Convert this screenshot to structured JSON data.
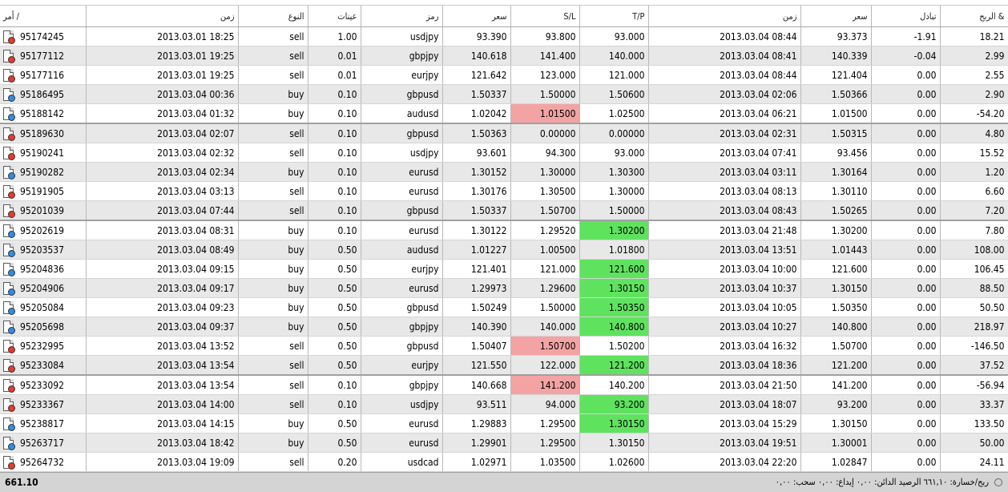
{
  "headers": {
    "ticket": "أمر  /",
    "open_time": "زمن",
    "type": "النوع",
    "size": "عينات",
    "symbol": "رمز",
    "open_price": "سعر",
    "sl": "S/L",
    "tp": "T/P",
    "close_time": "زمن",
    "close_price": "سعر",
    "swap": "تبادل",
    "profit": "الربح &"
  },
  "rows": [
    {
      "ticket": "95174245",
      "open_time": "2013.03.01 18:25",
      "type": "sell",
      "size": "1.00",
      "symbol": "usdjpy",
      "open_price": "93.390",
      "sl": "93.800",
      "tp": "93.000",
      "close_time": "2013.03.04 08:44",
      "close_price": "93.373",
      "swap": "-1.91",
      "profit": "18.21"
    },
    {
      "ticket": "95177112",
      "open_time": "2013.03.01 19:25",
      "type": "sell",
      "size": "0.01",
      "symbol": "gbpjpy",
      "open_price": "140.618",
      "sl": "141.400",
      "tp": "140.000",
      "close_time": "2013.03.04 08:41",
      "close_price": "140.339",
      "swap": "-0.04",
      "profit": "2.99"
    },
    {
      "ticket": "95177116",
      "open_time": "2013.03.01 19:25",
      "type": "sell",
      "size": "0.01",
      "symbol": "eurjpy",
      "open_price": "121.642",
      "sl": "123.000",
      "tp": "121.000",
      "close_time": "2013.03.04 08:44",
      "close_price": "121.404",
      "swap": "0.00",
      "profit": "2.55"
    },
    {
      "ticket": "95186495",
      "open_time": "2013.03.04 00:36",
      "type": "buy",
      "size": "0.10",
      "symbol": "gbpusd",
      "open_price": "1.50337",
      "sl": "1.50000",
      "tp": "1.50600",
      "close_time": "2013.03.04 02:06",
      "close_price": "1.50366",
      "swap": "0.00",
      "profit": "2.90"
    },
    {
      "ticket": "95188142",
      "open_time": "2013.03.04 01:32",
      "type": "buy",
      "size": "0.10",
      "symbol": "audusd",
      "open_price": "1.02042",
      "sl": "1.01500",
      "tp": "1.02500",
      "close_time": "2013.03.04 06:21",
      "close_price": "1.01500",
      "swap": "0.00",
      "profit": "-54.20",
      "sl_hit": true
    },
    {
      "ticket": "95189630",
      "open_time": "2013.03.04 02:07",
      "type": "sell",
      "size": "0.10",
      "symbol": "gbpusd",
      "open_price": "1.50363",
      "sl": "0.00000",
      "tp": "0.00000",
      "close_time": "2013.03.04 02:31",
      "close_price": "1.50315",
      "swap": "0.00",
      "profit": "4.80",
      "sep": true
    },
    {
      "ticket": "95190241",
      "open_time": "2013.03.04 02:32",
      "type": "sell",
      "size": "0.10",
      "symbol": "usdjpy",
      "open_price": "93.601",
      "sl": "94.300",
      "tp": "93.000",
      "close_time": "2013.03.04 07:41",
      "close_price": "93.456",
      "swap": "0.00",
      "profit": "15.52"
    },
    {
      "ticket": "95190282",
      "open_time": "2013.03.04 02:34",
      "type": "buy",
      "size": "0.10",
      "symbol": "eurusd",
      "open_price": "1.30152",
      "sl": "1.30000",
      "tp": "1.30300",
      "close_time": "2013.03.04 03:11",
      "close_price": "1.30164",
      "swap": "0.00",
      "profit": "1.20"
    },
    {
      "ticket": "95191905",
      "open_time": "2013.03.04 03:13",
      "type": "sell",
      "size": "0.10",
      "symbol": "eurusd",
      "open_price": "1.30176",
      "sl": "1.30500",
      "tp": "1.30000",
      "close_time": "2013.03.04 08:13",
      "close_price": "1.30110",
      "swap": "0.00",
      "profit": "6.60"
    },
    {
      "ticket": "95201039",
      "open_time": "2013.03.04 07:44",
      "type": "sell",
      "size": "0.10",
      "symbol": "gbpusd",
      "open_price": "1.50337",
      "sl": "1.50700",
      "tp": "1.50000",
      "close_time": "2013.03.04 08:43",
      "close_price": "1.50265",
      "swap": "0.00",
      "profit": "7.20"
    },
    {
      "ticket": "95202619",
      "open_time": "2013.03.04 08:31",
      "type": "buy",
      "size": "0.10",
      "symbol": "eurusd",
      "open_price": "1.30122",
      "sl": "1.29520",
      "tp": "1.30200",
      "close_time": "2013.03.04 21:48",
      "close_price": "1.30200",
      "swap": "0.00",
      "profit": "7.80",
      "tp_hit": true,
      "sep": true
    },
    {
      "ticket": "95203537",
      "open_time": "2013.03.04 08:49",
      "type": "buy",
      "size": "0.50",
      "symbol": "audusd",
      "open_price": "1.01227",
      "sl": "1.00500",
      "tp": "1.01800",
      "close_time": "2013.03.04 13:51",
      "close_price": "1.01443",
      "swap": "0.00",
      "profit": "108.00"
    },
    {
      "ticket": "95204836",
      "open_time": "2013.03.04 09:15",
      "type": "buy",
      "size": "0.50",
      "symbol": "eurjpy",
      "open_price": "121.401",
      "sl": "121.000",
      "tp": "121.600",
      "close_time": "2013.03.04 10:00",
      "close_price": "121.600",
      "swap": "0.00",
      "profit": "106.45",
      "tp_hit": true
    },
    {
      "ticket": "95204906",
      "open_time": "2013.03.04 09:17",
      "type": "buy",
      "size": "0.50",
      "symbol": "eurusd",
      "open_price": "1.29973",
      "sl": "1.29600",
      "tp": "1.30150",
      "close_time": "2013.03.04 10:37",
      "close_price": "1.30150",
      "swap": "0.00",
      "profit": "88.50",
      "tp_hit": true
    },
    {
      "ticket": "95205084",
      "open_time": "2013.03.04 09:23",
      "type": "buy",
      "size": "0.50",
      "symbol": "gbpusd",
      "open_price": "1.50249",
      "sl": "1.50000",
      "tp": "1.50350",
      "close_time": "2013.03.04 10:05",
      "close_price": "1.50350",
      "swap": "0.00",
      "profit": "50.50",
      "tp_hit": true
    },
    {
      "ticket": "95205698",
      "open_time": "2013.03.04 09:37",
      "type": "buy",
      "size": "0.50",
      "symbol": "gbpjpy",
      "open_price": "140.390",
      "sl": "140.000",
      "tp": "140.800",
      "close_time": "2013.03.04 10:27",
      "close_price": "140.800",
      "swap": "0.00",
      "profit": "218.97",
      "tp_hit": true
    },
    {
      "ticket": "95232995",
      "open_time": "2013.03.04 13:52",
      "type": "sell",
      "size": "0.50",
      "symbol": "gbpusd",
      "open_price": "1.50407",
      "sl": "1.50700",
      "tp": "1.50200",
      "close_time": "2013.03.04 16:32",
      "close_price": "1.50700",
      "swap": "0.00",
      "profit": "-146.50",
      "sl_hit": true
    },
    {
      "ticket": "95233084",
      "open_time": "2013.03.04 13:54",
      "type": "sell",
      "size": "0.50",
      "symbol": "eurjpy",
      "open_price": "121.550",
      "sl": "122.000",
      "tp": "121.200",
      "close_time": "2013.03.04 18:36",
      "close_price": "121.200",
      "swap": "0.00",
      "profit": "37.52",
      "tp_hit": true
    },
    {
      "ticket": "95233092",
      "open_time": "2013.03.04 13:54",
      "type": "sell",
      "size": "0.10",
      "symbol": "gbpjpy",
      "open_price": "140.668",
      "sl": "141.200",
      "tp": "140.200",
      "close_time": "2013.03.04 21:50",
      "close_price": "141.200",
      "swap": "0.00",
      "profit": "-56.94",
      "sl_hit": true,
      "sep": true
    },
    {
      "ticket": "95233367",
      "open_time": "2013.03.04 14:00",
      "type": "sell",
      "size": "0.10",
      "symbol": "usdjpy",
      "open_price": "93.511",
      "sl": "94.000",
      "tp": "93.200",
      "close_time": "2013.03.04 18:07",
      "close_price": "93.200",
      "swap": "0.00",
      "profit": "33.37",
      "tp_hit": true
    },
    {
      "ticket": "95238817",
      "open_time": "2013.03.04 14:15",
      "type": "buy",
      "size": "0.50",
      "symbol": "eurusd",
      "open_price": "1.29883",
      "sl": "1.29500",
      "tp": "1.30150",
      "close_time": "2013.03.04 15:29",
      "close_price": "1.30150",
      "swap": "0.00",
      "profit": "133.50",
      "tp_hit": true
    },
    {
      "ticket": "95263717",
      "open_time": "2013.03.04 18:42",
      "type": "buy",
      "size": "0.50",
      "symbol": "eurusd",
      "open_price": "1.29901",
      "sl": "1.29500",
      "tp": "1.30150",
      "close_time": "2013.03.04 19:51",
      "close_price": "1.30001",
      "swap": "0.00",
      "profit": "50.00"
    },
    {
      "ticket": "95264732",
      "open_time": "2013.03.04 19:09",
      "type": "sell",
      "size": "0.20",
      "symbol": "usdcad",
      "open_price": "1.02971",
      "sl": "1.03500",
      "tp": "1.02600",
      "close_time": "2013.03.04 22:20",
      "close_price": "1.02847",
      "swap": "0.00",
      "profit": "24.11"
    }
  ],
  "footer": {
    "total": "661.10",
    "summary": "ربح/خسارة: ٦٦١,١٠  الرصيد الدائن: ٠,٠٠  إيداع: ٠,٠٠  سحب: ٠,٠٠"
  },
  "colors": {
    "sl_highlight": "#f3a3a3",
    "tp_highlight": "#5fe35f",
    "sell_dot": "#e8392a",
    "buy_dot": "#2b8ee8"
  }
}
